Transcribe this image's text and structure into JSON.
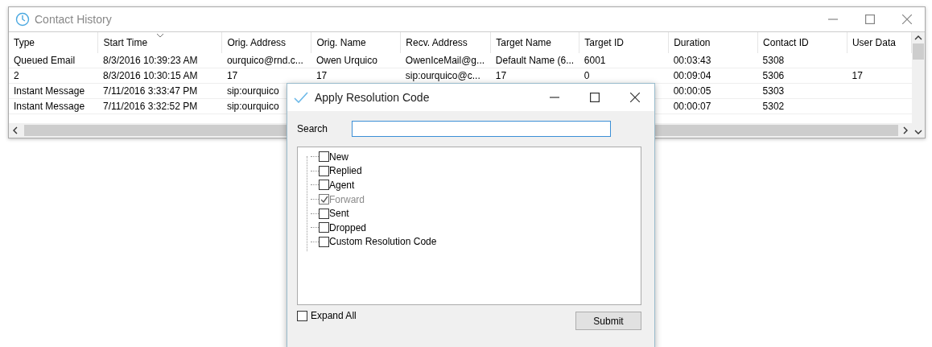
{
  "window": {
    "title": "Contact History"
  },
  "table": {
    "columns": [
      {
        "label": "Type",
        "sorted": false
      },
      {
        "label": "Start Time",
        "sorted": true
      },
      {
        "label": "Orig. Address",
        "sorted": false
      },
      {
        "label": "Orig. Name",
        "sorted": false
      },
      {
        "label": "Recv. Address",
        "sorted": false
      },
      {
        "label": "Target Name",
        "sorted": false
      },
      {
        "label": "Target ID",
        "sorted": false
      },
      {
        "label": "Duration",
        "sorted": false
      },
      {
        "label": "Contact ID",
        "sorted": false
      },
      {
        "label": "User Data",
        "sorted": false
      }
    ],
    "rows": [
      {
        "type": "Queued Email",
        "start_time": "8/3/2016 10:39:23 AM",
        "orig_address": "ourquico@rnd.c...",
        "orig_name": "Owen Urquico",
        "recv_address": "OwenIceMail@g...",
        "target_name": "Default Name (6...",
        "target_id": "6001",
        "duration": "00:03:43",
        "contact_id": "5308"
      },
      {
        "type": "2",
        "start_time": "8/3/2016 10:30:15 AM",
        "orig_address": "17",
        "orig_name": "17",
        "recv_address": "sip:ourquico@c...",
        "target_name": "17",
        "target_id": "0",
        "duration": "00:09:04",
        "contact_id": "5306",
        "user_data": "17"
      },
      {
        "type": "Instant Message",
        "start_time": "7/11/2016 3:33:47 PM",
        "orig_address": "sip:ourquico",
        "duration": "00:00:05",
        "contact_id": "5303"
      },
      {
        "type": "Instant Message",
        "start_time": "7/11/2016 3:32:52 PM",
        "orig_address": "sip:ourquico",
        "duration": "00:00:07",
        "contact_id": "5302"
      }
    ]
  },
  "dialog": {
    "title": "Apply Resolution Code",
    "search": {
      "label": "Search",
      "focused": true
    },
    "codes": [
      {
        "label": "New",
        "checked": false,
        "disabled": false
      },
      {
        "label": "Replied",
        "checked": false,
        "disabled": false
      },
      {
        "label": "Agent",
        "checked": false,
        "disabled": false
      },
      {
        "label": "Forward",
        "checked": true,
        "disabled": true
      },
      {
        "label": "Sent",
        "checked": false,
        "disabled": false
      },
      {
        "label": "Dropped",
        "checked": false,
        "disabled": false
      },
      {
        "label": "Custom Resolution Code",
        "checked": false,
        "disabled": false
      }
    ],
    "expand_all": {
      "label": "Expand All",
      "checked": false
    },
    "submit": "Submit"
  }
}
